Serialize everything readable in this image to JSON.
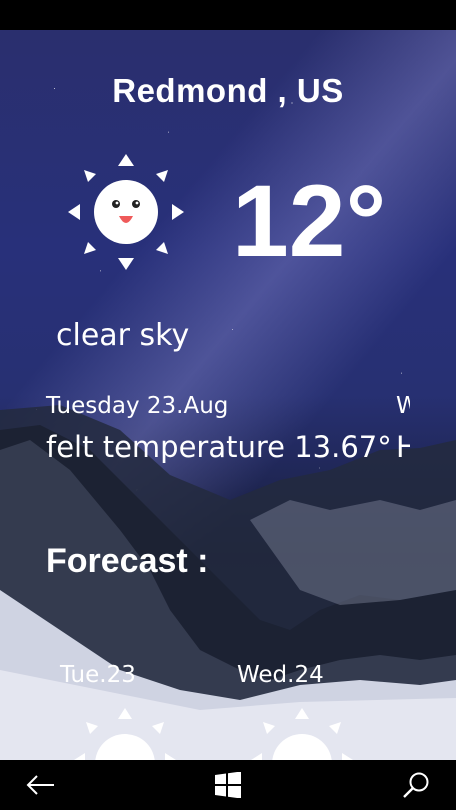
{
  "weather": {
    "location": "Redmond , US",
    "temperature": "12°",
    "condition": "clear sky",
    "date": "Tuesday 23.Aug",
    "truncated_right_label": "W",
    "felt_temperature": "felt temperature 13.67°",
    "truncated_right_value": "H",
    "condition_icon": "sun-face-icon"
  },
  "forecast": {
    "title": "Forecast :",
    "days": [
      {
        "label": "Tue.23",
        "icon": "sun-icon"
      },
      {
        "label": "Wed.24",
        "icon": "sun-icon"
      }
    ]
  },
  "navbar": {
    "back_icon": "back-arrow-icon",
    "home_icon": "windows-logo-icon",
    "search_icon": "search-icon"
  },
  "colors": {
    "sky_top": "#2a2f6e",
    "sky_mid": "#273072",
    "mountain": "#1a1f2e",
    "snow": "#d8dbe8",
    "navbar": "#000000",
    "sun_mouth": "#ef5a5a"
  }
}
